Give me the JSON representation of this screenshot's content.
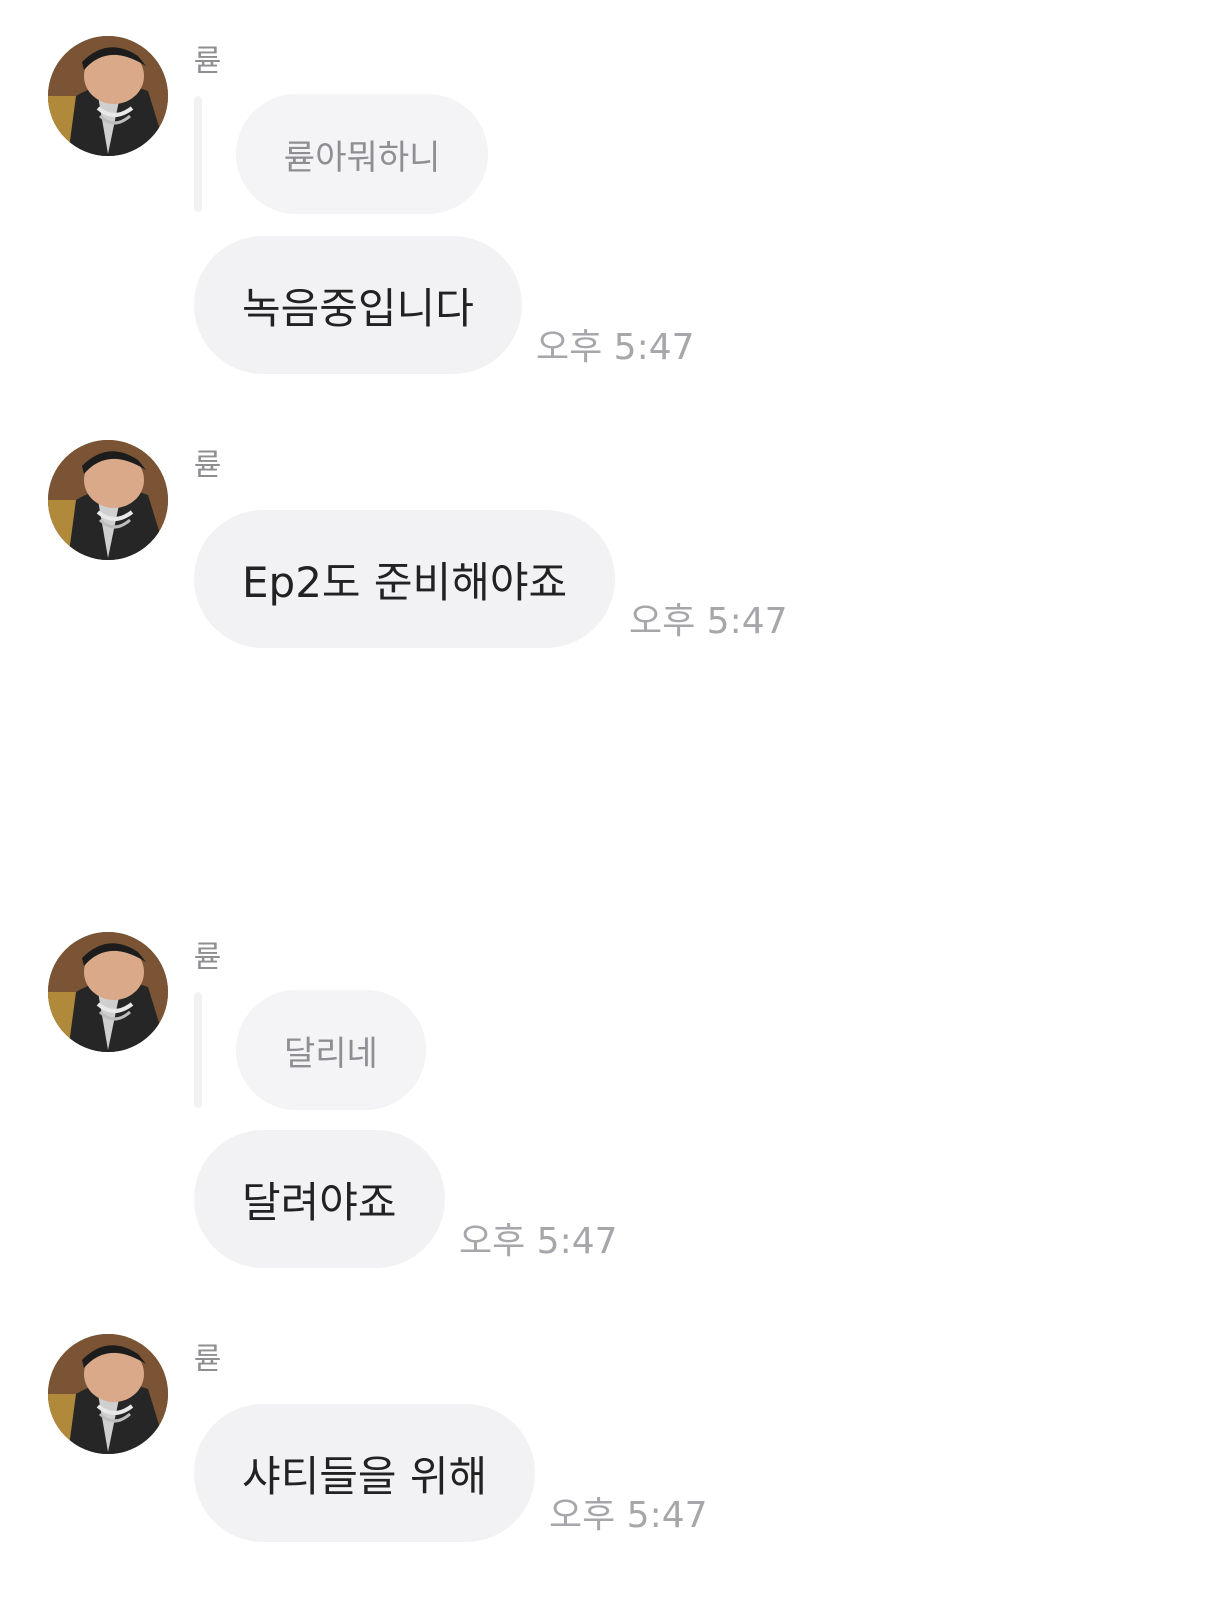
{
  "avatar_icon": "profile-photo",
  "colors": {
    "bubble": "#f2f2f5",
    "reply_bubble": "#f4f4f6",
    "message_text": "#222222",
    "meta_text": "#8e8e93"
  },
  "messages": [
    {
      "sender": "륟",
      "reply_to": "륟아뭐하니",
      "text": "녹음중입니다",
      "time": "오후 5:47"
    },
    {
      "sender": "륟",
      "text": "Ep2도 준비해야죠",
      "time": "오후 5:47"
    },
    {
      "sender": "륟",
      "reply_to": "달리네",
      "text": "달려야죠",
      "time": "오후 5:47"
    },
    {
      "sender": "륟",
      "text": "샤티들을 위해",
      "time": "오후 5:47"
    }
  ]
}
